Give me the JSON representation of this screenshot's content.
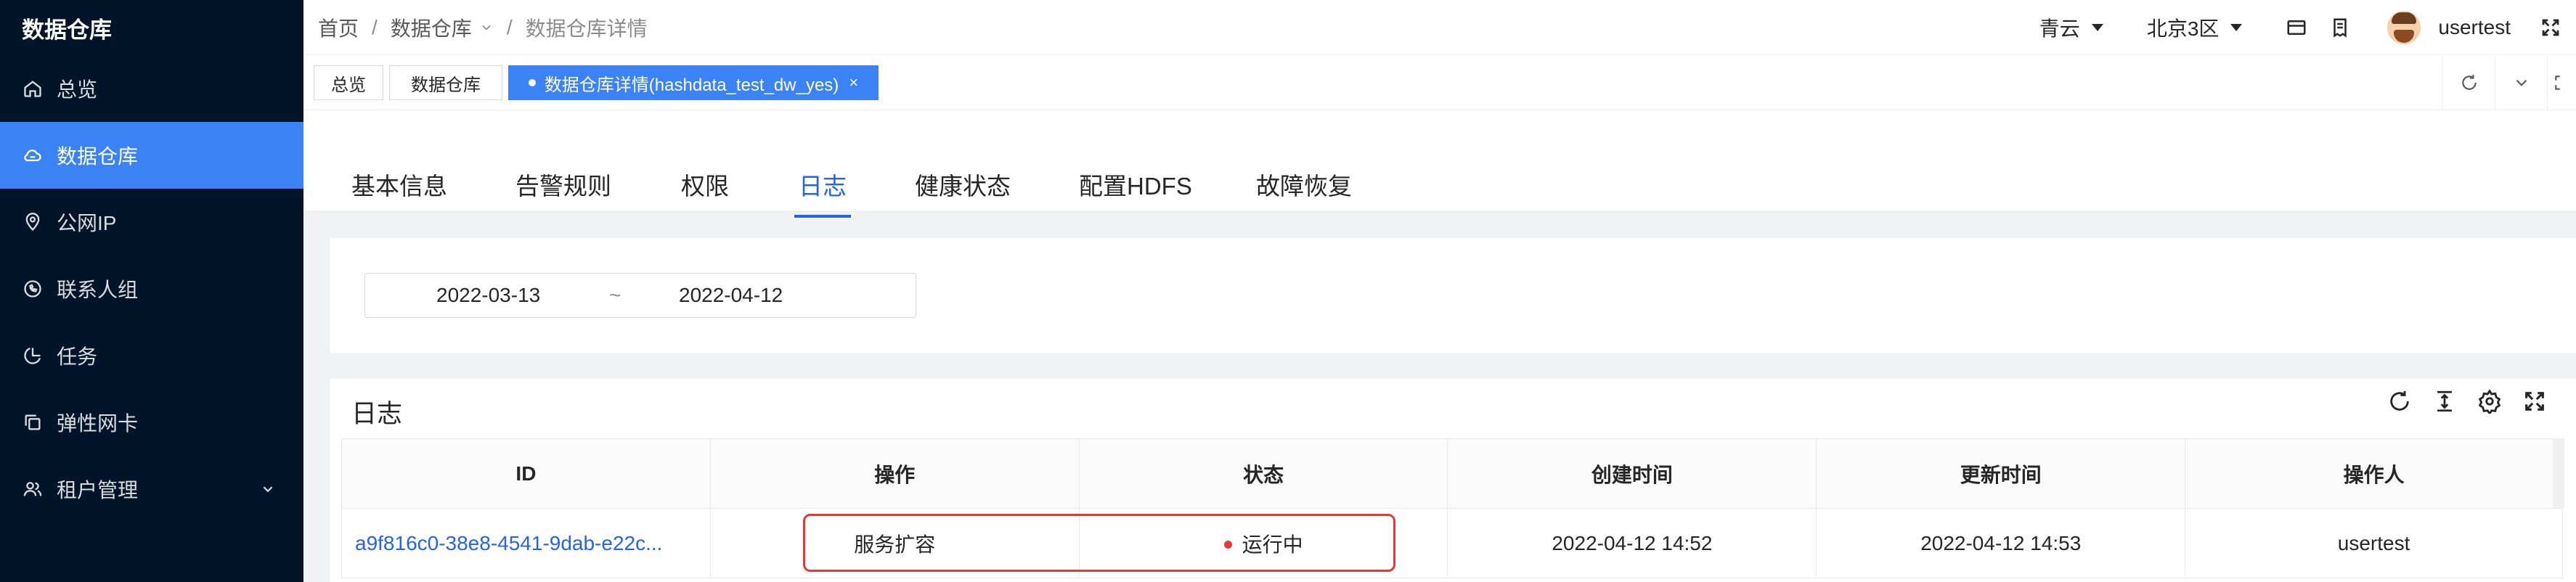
{
  "sidebar": {
    "brand": "数据仓库",
    "items": [
      {
        "label": "总览",
        "icon": "home-icon",
        "active": false
      },
      {
        "label": "数据仓库",
        "icon": "cloud-icon",
        "active": true
      },
      {
        "label": "公网IP",
        "icon": "location-icon",
        "active": false
      },
      {
        "label": "联系人组",
        "icon": "phone-chat-icon",
        "active": false
      },
      {
        "label": "任务",
        "icon": "pie-icon",
        "active": false
      },
      {
        "label": "弹性网卡",
        "icon": "copy-icon",
        "active": false
      },
      {
        "label": "租户管理",
        "icon": "user-group-icon",
        "active": false,
        "expandable": true
      }
    ]
  },
  "header": {
    "breadcrumb": [
      "首页",
      "数据仓库",
      "数据仓库详情"
    ],
    "region_primary": "青云",
    "region_zone": "北京3区",
    "username": "usertest"
  },
  "page_tabs": [
    {
      "label": "总览",
      "active": false
    },
    {
      "label": "数据仓库",
      "active": false
    },
    {
      "label": "数据仓库详情(hashdata_test_dw_yes)",
      "active": true,
      "close": "×"
    }
  ],
  "detail_tabs": [
    {
      "label": "基本信息",
      "active": false
    },
    {
      "label": "告警规则",
      "active": false
    },
    {
      "label": "权限",
      "active": false
    },
    {
      "label": "日志",
      "active": true
    },
    {
      "label": "健康状态",
      "active": false
    },
    {
      "label": "配置HDFS",
      "active": false
    },
    {
      "label": "故障恢复",
      "active": false
    }
  ],
  "filter": {
    "start_date": "2022-03-13",
    "separator": "~",
    "end_date": "2022-04-12"
  },
  "log_panel": {
    "title": "日志",
    "columns": [
      "ID",
      "操作",
      "状态",
      "创建时间",
      "更新时间",
      "操作人"
    ],
    "rows": [
      {
        "id": "a9f816c0-38e8-4541-9dab-e22c...",
        "operation": "服务扩容",
        "status": "运行中",
        "created": "2022-04-12 14:52",
        "updated": "2022-04-12 14:53",
        "operator": "usertest"
      }
    ]
  },
  "colors": {
    "sidebar_bg": "#001529",
    "accent": "#3b82f6",
    "link": "#2563eb",
    "status_running": "#e53935",
    "highlight": "#e53935"
  }
}
